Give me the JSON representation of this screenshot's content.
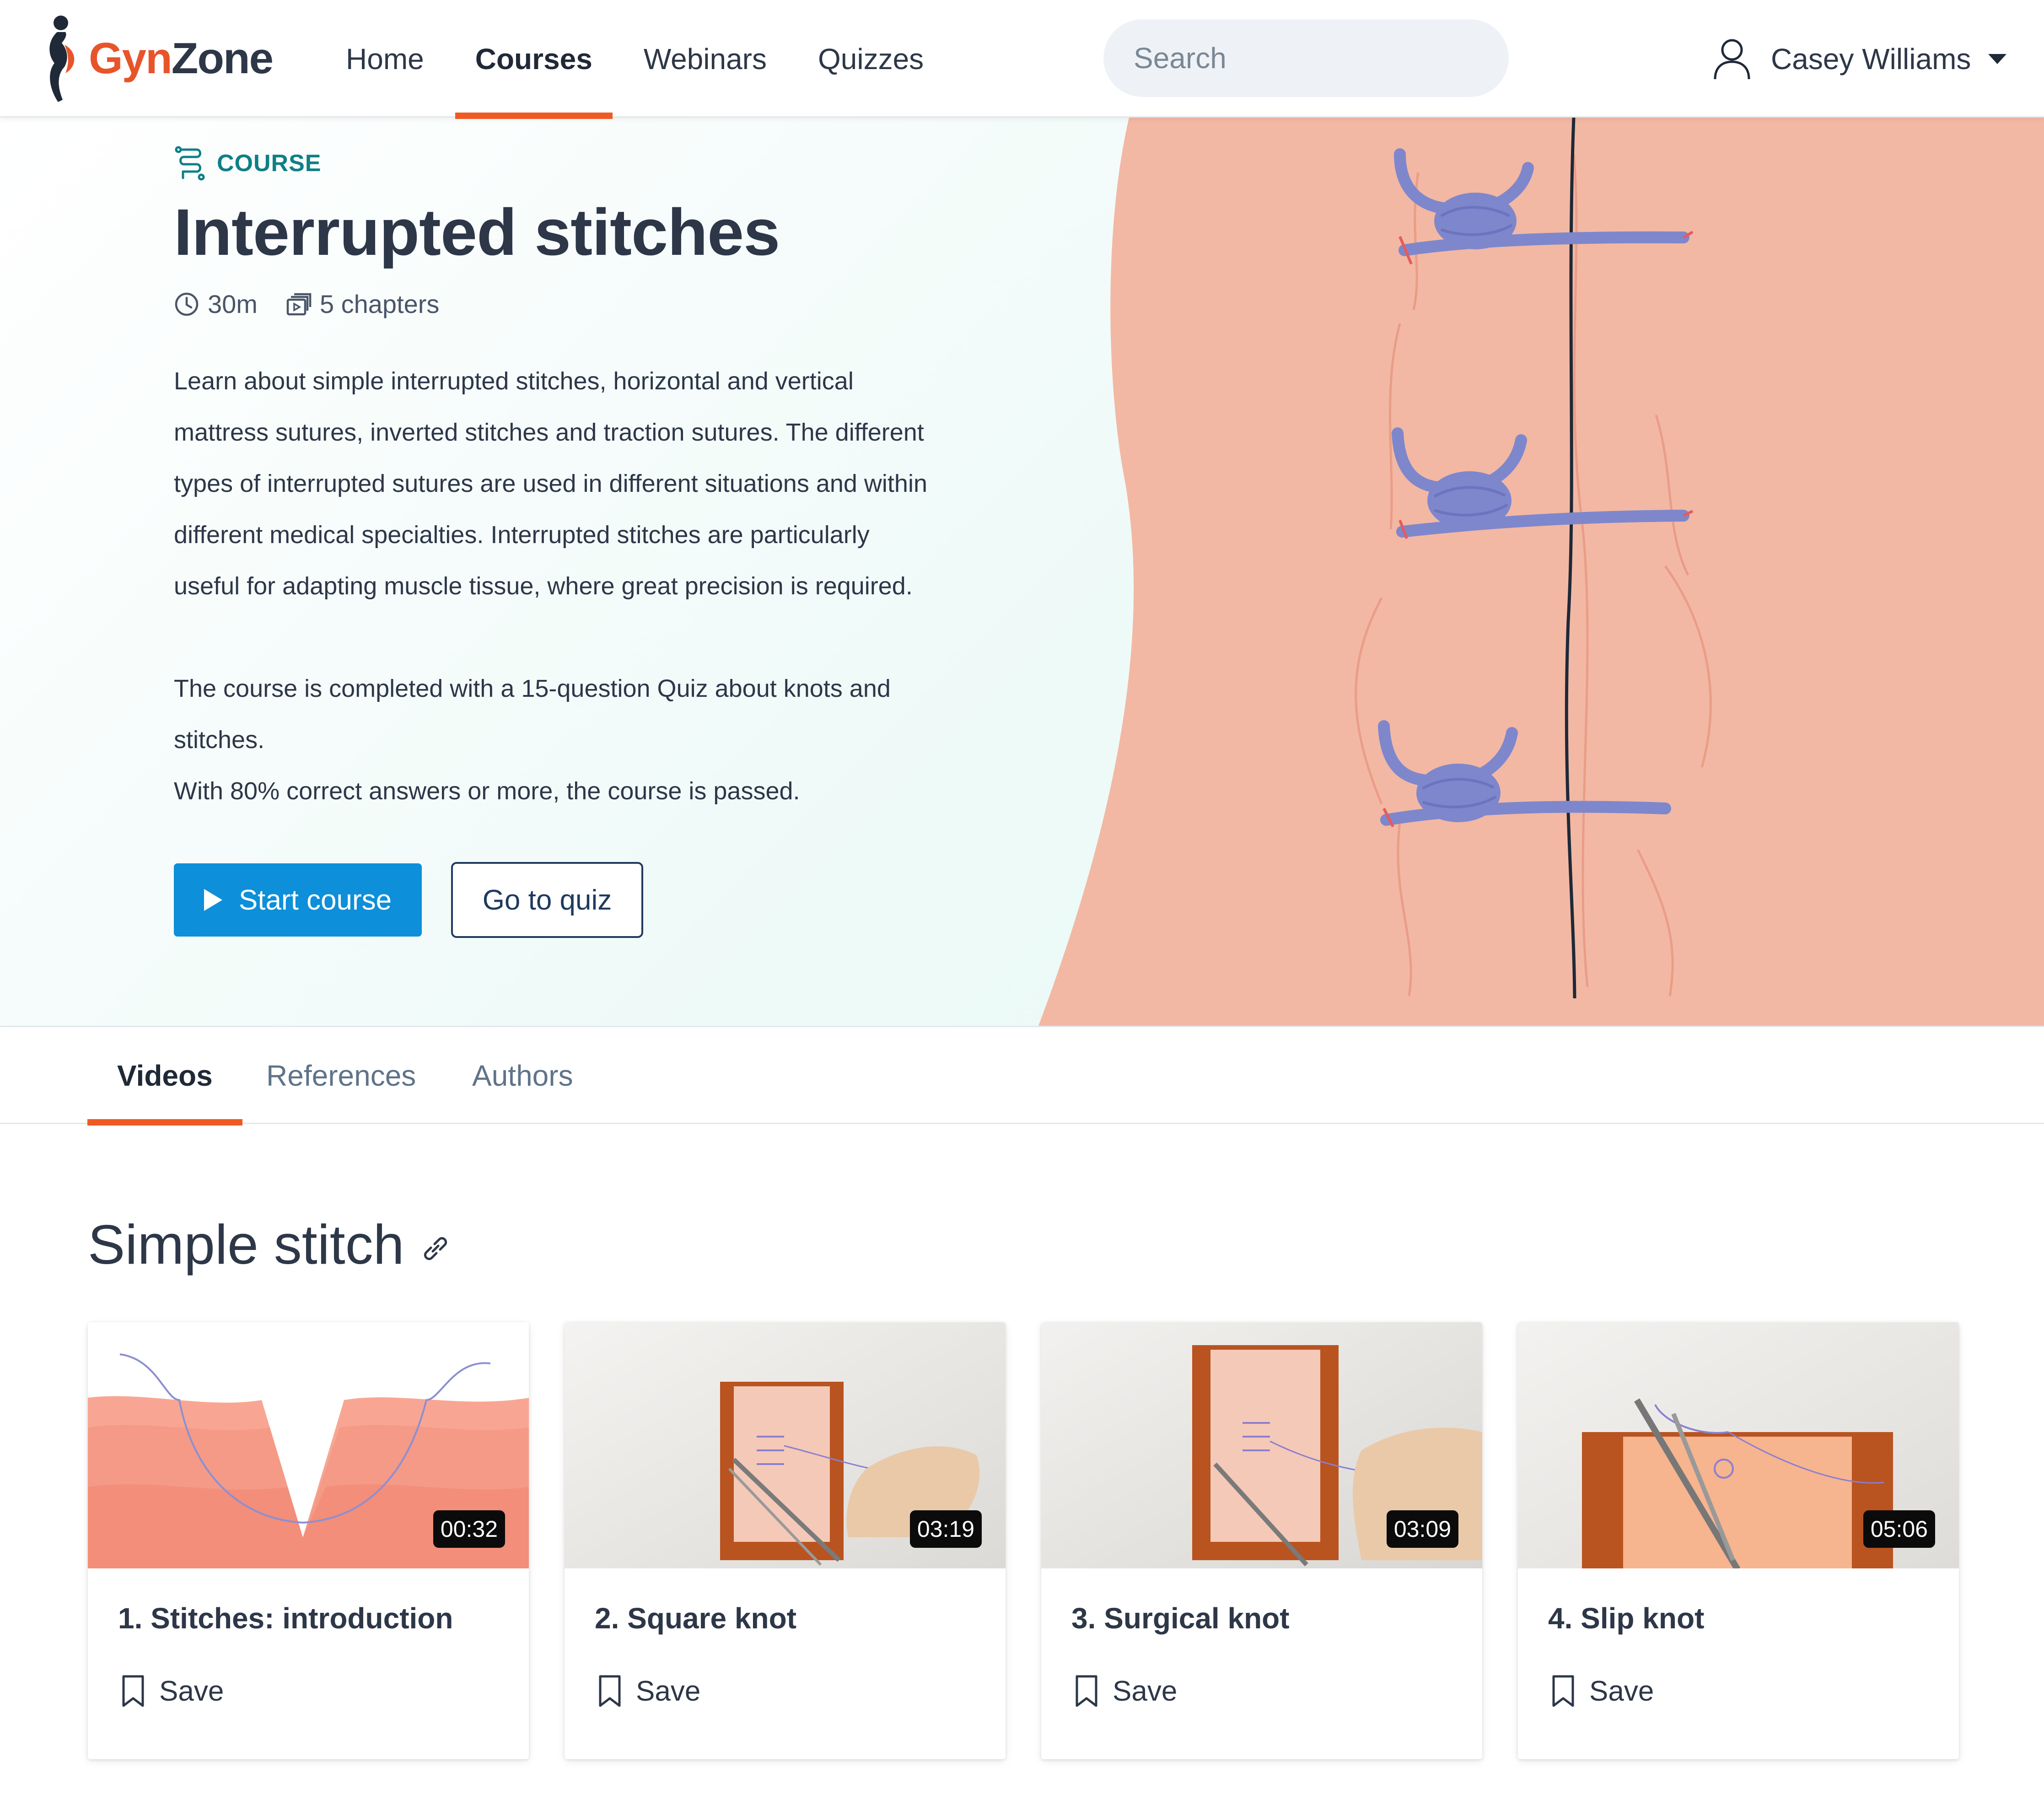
{
  "header": {
    "logo_part1": "Gyn",
    "logo_part2": "Zone",
    "nav": [
      {
        "label": "Home",
        "active": false
      },
      {
        "label": "Courses",
        "active": true
      },
      {
        "label": "Webinars",
        "active": false
      },
      {
        "label": "Quizzes",
        "active": false
      }
    ],
    "search_placeholder": "Search",
    "user_name": "Casey Williams",
    "icons": {
      "search": "search-icon",
      "user": "user-icon",
      "caret": "caret-down-icon"
    }
  },
  "hero": {
    "tag": "COURSE",
    "title": "Interrupted stitches",
    "duration": "30m",
    "chapters": "5 chapters",
    "description": [
      "Learn about simple interrupted stitches, horizontal and vertical",
      "mattress sutures, inverted stitches and traction sutures. The different",
      "types of interrupted sutures are used in different situations and within",
      "different medical specialties. Interrupted stitches are particularly",
      "useful for adapting muscle tissue, where great precision is required."
    ],
    "description2": [
      "The course is completed with a 15-question Quiz about knots and",
      "stitches.",
      "With 80% correct answers or more, the course is passed."
    ],
    "start_button": "Start course",
    "quiz_button": "Go to quiz"
  },
  "tabs": [
    {
      "label": "Videos",
      "active": true
    },
    {
      "label": "References",
      "active": false
    },
    {
      "label": "Authors",
      "active": false
    }
  ],
  "section": {
    "title": "Simple stitch",
    "cards": [
      {
        "title": "1. Stitches: introduction",
        "duration": "00:32",
        "save_label": "Save"
      },
      {
        "title": "2. Square knot",
        "duration": "03:19",
        "save_label": "Save"
      },
      {
        "title": "3. Surgical knot",
        "duration": "03:09",
        "save_label": "Save"
      },
      {
        "title": "4. Slip knot",
        "duration": "05:06",
        "save_label": "Save"
      }
    ]
  },
  "colors": {
    "accent_orange": "#f05a22",
    "primary_blue": "#0d8fd9",
    "teal": "#0f7f86",
    "skin": "#f2b8a4",
    "suture": "#7e87cc"
  }
}
